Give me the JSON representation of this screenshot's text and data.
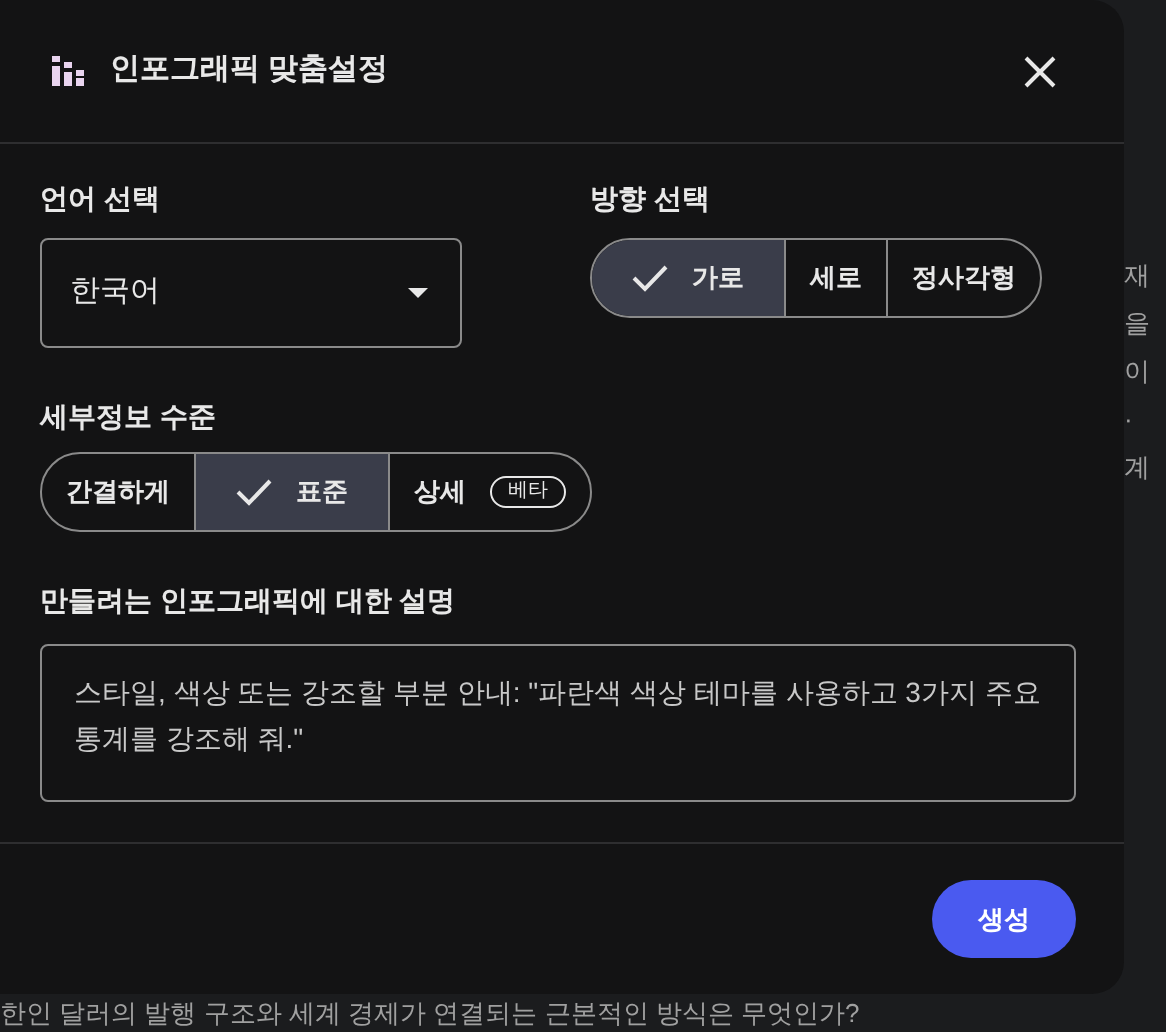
{
  "background": {
    "side_lines": [
      "재",
      "을",
      "이",
      "·",
      "계"
    ],
    "bottom_line": "한인 달러의 발행 구조와 세계 경제가 연결되는 근본적인 방식은 무엇인가?"
  },
  "dialog": {
    "title": "인포그래픽 맞춤설정",
    "language": {
      "label": "언어 선택",
      "value": "한국어"
    },
    "orientation": {
      "label": "방향 선택",
      "options": [
        {
          "label": "가로",
          "selected": true
        },
        {
          "label": "세로",
          "selected": false
        },
        {
          "label": "정사각형",
          "selected": false
        }
      ]
    },
    "detail": {
      "label": "세부정보 수준",
      "options": [
        {
          "label": "간결하게",
          "selected": false
        },
        {
          "label": "표준",
          "selected": true
        },
        {
          "label": "상세",
          "selected": false,
          "badge": "베타"
        }
      ]
    },
    "description": {
      "label": "만들려는 인포그래픽에 대한 설명",
      "placeholder": "스타일, 색상 또는 강조할 부분 안내: \"파란색 색상 테마를 사용하고 3가지 주요 통계를 강조해 줘.\""
    },
    "submit": "생성"
  }
}
